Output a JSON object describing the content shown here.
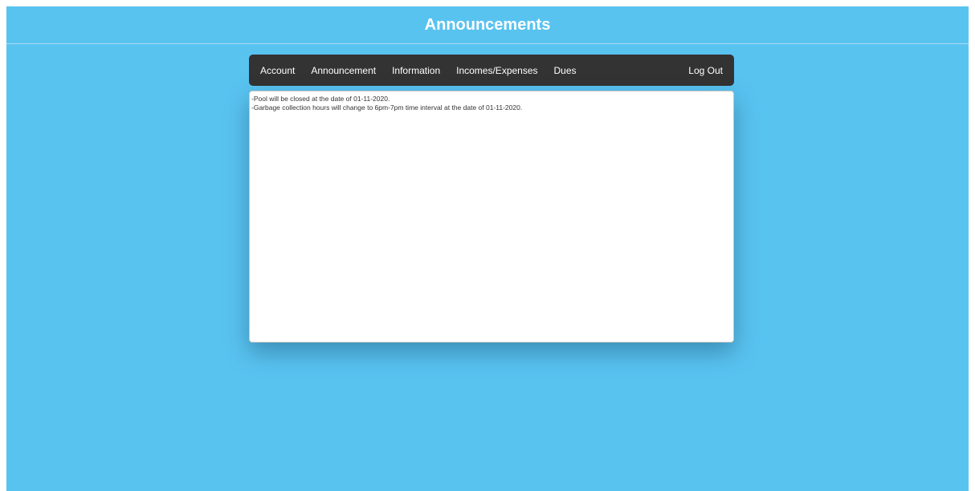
{
  "header": {
    "title": "Announcements"
  },
  "nav": {
    "items": [
      {
        "label": "Account"
      },
      {
        "label": "Announcement"
      },
      {
        "label": "Information"
      },
      {
        "label": "Incomes/Expenses"
      },
      {
        "label": "Dues"
      }
    ],
    "logout_label": "Log Out"
  },
  "announcements": {
    "lines": [
      "-Pool will be closed at the date of 01-11-2020.",
      "-Garbage collection hours will change to 6pm-7pm time interval at the date of 01-11-2020."
    ]
  },
  "colors": {
    "background": "#59c3f0",
    "navbar": "#333333",
    "panel": "#ffffff"
  }
}
